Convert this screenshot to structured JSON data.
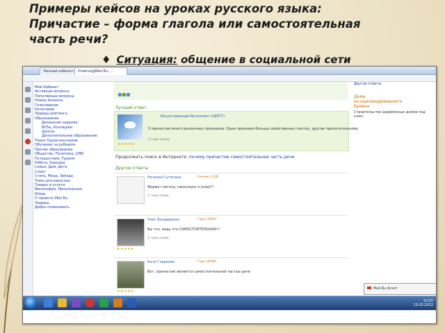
{
  "slide": {
    "title_line1": "Примеры кейсов на уроках русского  языка:",
    "title_line2": "Причастие – форма глагола или самостоятельная",
    "title_line3": "часть речи?",
    "bullet_lead": "Ситуация:",
    "bullet_rest": " общение в социальной сети"
  },
  "browser": {
    "tabs": [
      "Личный кабинет…",
      "Ответы@Mail.Ru: ..."
    ],
    "nav_items": [
      {
        "label": "Мой Кабинет",
        "sub": false
      },
      {
        "label": "Активные вопросы",
        "sub": false
      },
      {
        "label": "Популярные вопросы",
        "sub": false
      },
      {
        "label": "Новые вопросы",
        "sub": false
      },
      {
        "label": "Голосование",
        "sub": false
      },
      {
        "label": "Категории",
        "sub": false
      },
      {
        "label": "Лидеры рейтинга",
        "sub": false
      },
      {
        "label": "Образование",
        "sub": false
      },
      {
        "label": "Домашние задания",
        "sub": true
      },
      {
        "label": "ВУЗы, Колледжи",
        "sub": true
      },
      {
        "label": "Школы",
        "sub": true
      },
      {
        "label": "Дополнительное образование",
        "sub": true
      },
      {
        "label": "Поиск Одноклассников",
        "sub": false
      },
      {
        "label": "Обучение за рубежом",
        "sub": false
      },
      {
        "label": "Прочее образование",
        "sub": false
      },
      {
        "label": "Общество, Политика, СМИ",
        "sub": false
      },
      {
        "label": "Путешествия, Туризм",
        "sub": false
      },
      {
        "label": "Работа, Карьера",
        "sub": false
      },
      {
        "label": "Семья, Дом, Дети",
        "sub": false
      },
      {
        "label": "Спорт",
        "sub": false
      },
      {
        "label": "Стиль, Мода, Звёзды",
        "sub": false
      },
      {
        "label": "Темы для взрослых",
        "sub": false
      },
      {
        "label": "Товары и услуги",
        "sub": false
      },
      {
        "label": "Философия, Непознанное",
        "sub": false
      },
      {
        "label": "Юмор",
        "sub": false
      },
      {
        "label": "О проекте Mail.Ru",
        "sub": false
      },
      {
        "label": "Лидеры",
        "sub": false
      },
      {
        "label": "Добро пожаловать",
        "sub": false
      }
    ],
    "best_answer_label": "Лучший ответ",
    "best_answer_author": "Искусственный Интеллект (16877)",
    "best_answer_text": "У причастия много различных признаков. Одни признаки больше свойственны глаголу, другие прилагательному",
    "best_answer_meta": "2 года    назад",
    "continue_lead": "Продолжить поиск в Интернете:",
    "continue_query": "почему причастие самостоятельная часть речи",
    "other_answers_label": "Другие ответы",
    "answers": [
      {
        "author": "Наталья Сутягина",
        "rank": "Ученик (118)",
        "text": "Форма глагола, насколько я знаю!!!",
        "meta": "2 года    назад"
      },
      {
        "author": "Олег Бондаренко",
        "rank": "Гуру (3240)",
        "text": "Вы что, ведь это САМОСТОЯТЕЛЬНАЯ!!!",
        "meta": "2 года    назад"
      },
      {
        "author": "Катя Гладкова",
        "rank": "Гуру (4036)",
        "text": "Вот, причастие является самостоятельной частью речи",
        "meta": "2 года    назад"
      }
    ],
    "right_col": {
      "line1": "Другие ответы",
      "ad_title": "Дома",
      "ad_line2": "из оцилиндрованного",
      "ad_line3": "бревна",
      "ad_text": "Строительство деревянных домов под ключ"
    },
    "mail_popup": "Mail.Ru Агент",
    "tray_time": "12:07",
    "tray_date": "15.03.2012"
  },
  "colors": {
    "best_bg": "#eaf5dc",
    "link": "#1a3ea8",
    "green_label": "#4a8a1f",
    "taskbar": "#1d3e72"
  }
}
